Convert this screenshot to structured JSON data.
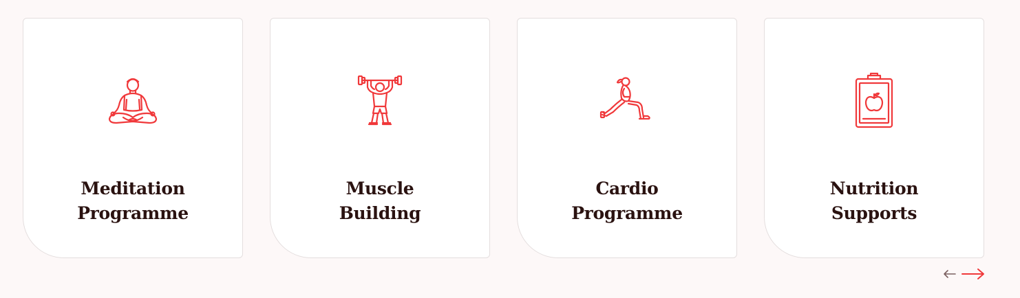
{
  "cards": [
    {
      "title_line1": "Meditation",
      "title_line2": "Programme",
      "icon": "meditation-icon"
    },
    {
      "title_line1": "Muscle",
      "title_line2": "Building",
      "icon": "weightlifting-icon"
    },
    {
      "title_line1": "Cardio",
      "title_line2": "Programme",
      "icon": "lunge-exercise-icon"
    },
    {
      "title_line1": "Nutrition",
      "title_line2": "Supports",
      "icon": "nutrition-clipboard-icon"
    }
  ],
  "carousel_nav": {
    "prev_icon": "arrow-left-icon",
    "next_icon": "arrow-right-icon"
  },
  "colors": {
    "accent": "#f0383a",
    "title_text": "#2a1210",
    "card_bg": "#ffffff",
    "card_border": "#e4dede",
    "page_bg": "#fdf8f8",
    "prev_arrow": "#7a5f5f"
  }
}
